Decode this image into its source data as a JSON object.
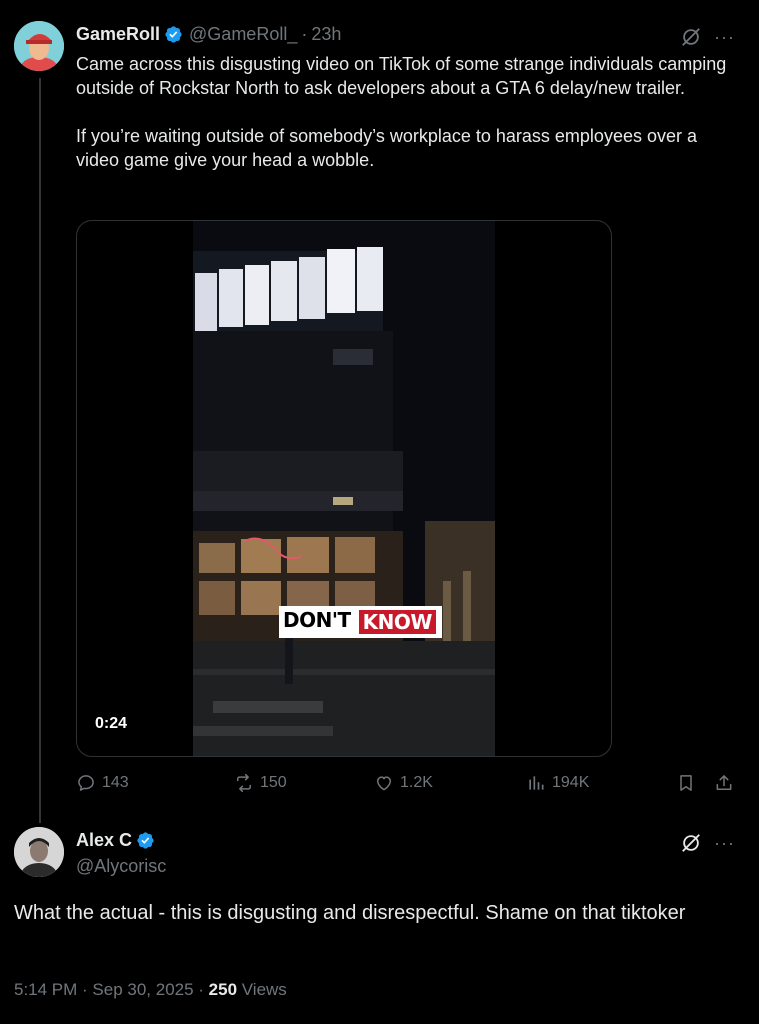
{
  "tweet": {
    "author_name": "GameRoll",
    "author_handle": "@GameRoll_",
    "separator": "·",
    "time": "23h",
    "text_p1": "Came across this disgusting video on TikTok of some strange individuals camping outside of Rockstar North to ask developers about a GTA 6 delay/new trailer.",
    "text_p2": "If you’re waiting outside of somebody’s workplace to harass employees over a video game give your head a wobble.",
    "video_duration": "0:24",
    "video_caption_1": "DON'T",
    "video_caption_2": "KNOW",
    "actions": {
      "replies": "143",
      "reposts": "150",
      "likes": "1.2K",
      "views": "194K"
    }
  },
  "reply": {
    "author_name": "Alex C",
    "author_handle": "@Alycorisc",
    "text": "What the actual - this is disgusting and disrespectful. Shame on that tiktoker",
    "timestamp": "5:14 PM · Sep 30, 2025 · ",
    "views_count": "250",
    "views_label": " Views"
  },
  "icons": {
    "more": "···",
    "verified_color": "#1d9bf0"
  }
}
